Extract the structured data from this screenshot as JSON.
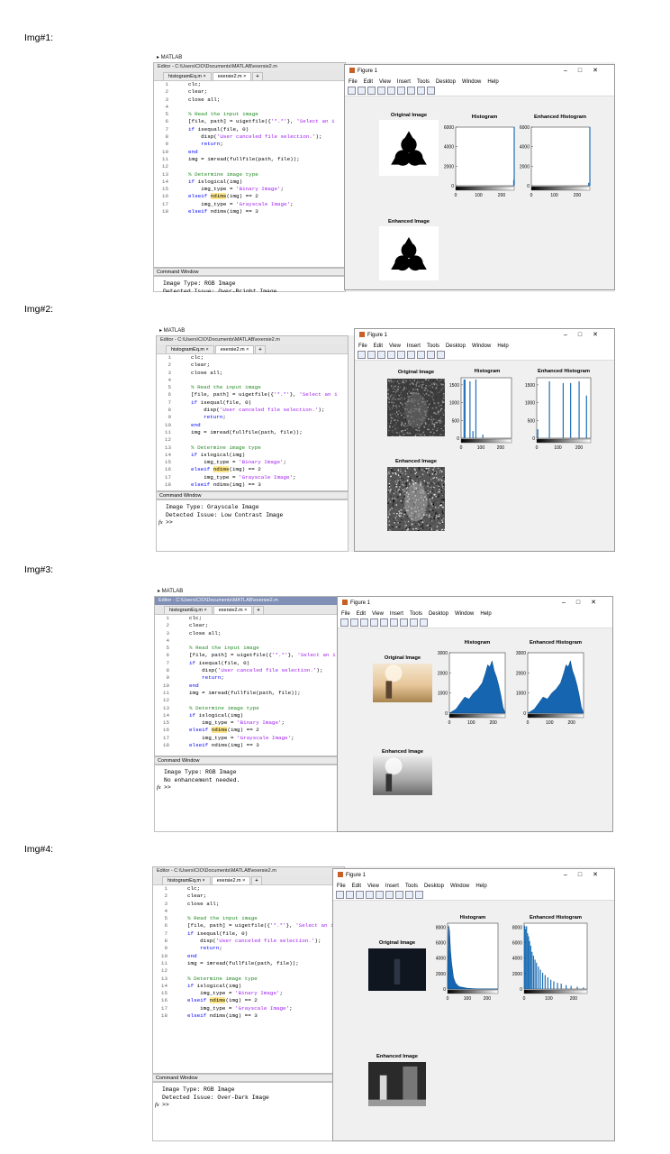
{
  "captions": [
    "Img#1:",
    "Img#2:",
    "Img#3:",
    "Img#4:"
  ],
  "matlab_label": "MATLAB",
  "editor": {
    "title": "Editor - C:\\Users\\CIO\\Documents\\MATLAB\\exersie2.m",
    "tabs": [
      "histogramEq.m",
      "exersie2.m",
      "+"
    ],
    "code_lines": [
      {
        "n": "1",
        "t": "clc;"
      },
      {
        "n": "2",
        "t": "clear;"
      },
      {
        "n": "3",
        "t": "close all;"
      },
      {
        "n": "4",
        "t": ""
      },
      {
        "n": "5",
        "t": "% Read the input image"
      },
      {
        "n": "6",
        "t": "[file, path] = uigetfile({'*.*'}, 'Select an i"
      },
      {
        "n": "7",
        "t": "if isequal(file, 0)"
      },
      {
        "n": "8",
        "t": "    disp('User canceled file selection.');"
      },
      {
        "n": "9",
        "t": "    return;"
      },
      {
        "n": "10",
        "t": "end"
      },
      {
        "n": "11",
        "t": "img = imread(fullfile(path, file));"
      },
      {
        "n": "12",
        "t": ""
      },
      {
        "n": "13",
        "t": "% Determine image type"
      },
      {
        "n": "14",
        "t": "if islogical(img)"
      },
      {
        "n": "15",
        "t": "    img_type = 'Binary Image';"
      },
      {
        "n": "16",
        "t": "elseif ndims(img) == 2"
      },
      {
        "n": "17",
        "t": "    img_type = 'Grayscale Image';"
      },
      {
        "n": "18",
        "t": "elseif ndims(img) == 3"
      }
    ]
  },
  "command_window": {
    "title": "Command Window",
    "prompt_symbol": "fx",
    "prompt": ">>"
  },
  "figure": {
    "title": "Figure 1",
    "menu": [
      "File",
      "Edit",
      "View",
      "Insert",
      "Tools",
      "Desktop",
      "Window",
      "Help"
    ],
    "window_buttons": [
      "–",
      "□",
      "✕"
    ],
    "original_title": "Original Image",
    "histogram_title": "Histogram",
    "enhanced_hist_title": "Enhanced Histogram",
    "enhanced_image_title": "Enhanced Image"
  },
  "shots": [
    {
      "output": [
        "Image Type: RGB Image",
        "Detected Issue: Over-Bright Image"
      ],
      "hist": {
        "yticks": [
          "6000",
          "4000",
          "2000",
          "0"
        ],
        "xticks": [
          "0",
          "100",
          "200"
        ]
      },
      "enh": {
        "yticks": [
          "6000",
          "4000",
          "2000",
          "0"
        ],
        "xticks": [
          "0",
          "100",
          "200"
        ]
      }
    },
    {
      "output": [
        "Image Type: Grayscale Image",
        "Detected Issue: Low Contrast Image"
      ],
      "hist": {
        "yticks": [
          "1500",
          "1000",
          "500",
          "0"
        ],
        "xticks": [
          "0",
          "100",
          "200"
        ]
      },
      "enh": {
        "yticks": [
          "1500",
          "1000",
          "500",
          "0"
        ],
        "xticks": [
          "0",
          "100",
          "200"
        ]
      }
    },
    {
      "output": [
        "Image Type: RGB Image",
        "No enhancement needed."
      ],
      "hist": {
        "yticks": [
          "3000",
          "2000",
          "1000",
          "0"
        ],
        "xticks": [
          "0",
          "100",
          "200"
        ]
      },
      "enh": {
        "yticks": [
          "3000",
          "2000",
          "1000",
          "0"
        ],
        "xticks": [
          "0",
          "100",
          "200"
        ]
      }
    },
    {
      "output": [
        "Image Type: RGB Image",
        "Detected Issue: Over-Dark Image"
      ],
      "hist": {
        "yticks": [
          "8000",
          "6000",
          "4000",
          "2000",
          "0"
        ],
        "xticks": [
          "0",
          "100",
          "200"
        ]
      },
      "enh": {
        "yticks": [
          "8000",
          "6000",
          "4000",
          "2000",
          "0"
        ],
        "xticks": [
          "0",
          "100",
          "200"
        ]
      }
    }
  ],
  "chart_data": [
    {
      "type": "bar",
      "title": "Histogram",
      "panel": "Img#1",
      "xlim": [
        0,
        255
      ],
      "ylim": [
        0,
        6000
      ],
      "bars": [
        {
          "x": 253,
          "y": 600
        },
        {
          "x": 255,
          "y": 6000
        }
      ]
    },
    {
      "type": "bar",
      "title": "Enhanced Histogram",
      "panel": "Img#1",
      "xlim": [
        0,
        255
      ],
      "ylim": [
        0,
        6000
      ],
      "bars": [
        {
          "x": 250,
          "y": 300
        },
        {
          "x": 255,
          "y": 6000
        }
      ]
    },
    {
      "type": "bar",
      "title": "Histogram",
      "panel": "Img#2",
      "xlim": [
        0,
        255
      ],
      "ylim": [
        0,
        1700
      ],
      "bars": [
        {
          "x": 15,
          "y": 1650
        },
        {
          "x": 20,
          "y": 1650
        },
        {
          "x": 45,
          "y": 1600
        },
        {
          "x": 60,
          "y": 200
        },
        {
          "x": 75,
          "y": 1650
        },
        {
          "x": 110,
          "y": 100
        }
      ]
    },
    {
      "type": "bar",
      "title": "Enhanced Histogram",
      "panel": "Img#2",
      "xlim": [
        0,
        255
      ],
      "ylim": [
        0,
        1700
      ],
      "bars": [
        {
          "x": 5,
          "y": 250
        },
        {
          "x": 60,
          "y": 1600
        },
        {
          "x": 125,
          "y": 1550
        },
        {
          "x": 160,
          "y": 1550
        },
        {
          "x": 200,
          "y": 1600
        },
        {
          "x": 235,
          "y": 1200
        }
      ]
    },
    {
      "type": "area",
      "title": "Histogram",
      "panel": "Img#3",
      "xlim": [
        0,
        255
      ],
      "ylim": [
        0,
        3000
      ],
      "x": [
        0,
        30,
        50,
        70,
        90,
        110,
        130,
        150,
        165,
        175,
        185,
        195,
        205,
        215,
        225,
        235,
        245,
        255
      ],
      "y": [
        0,
        200,
        500,
        800,
        700,
        1000,
        1200,
        1500,
        2000,
        2400,
        2300,
        2600,
        2100,
        1800,
        1400,
        900,
        300,
        0
      ]
    },
    {
      "type": "area",
      "title": "Enhanced Histogram",
      "panel": "Img#3",
      "xlim": [
        0,
        255
      ],
      "ylim": [
        0,
        3000
      ],
      "x": [
        0,
        30,
        50,
        70,
        90,
        110,
        130,
        150,
        165,
        175,
        185,
        195,
        205,
        215,
        225,
        235,
        245,
        255
      ],
      "y": [
        0,
        200,
        500,
        800,
        700,
        1000,
        1200,
        1500,
        2000,
        2400,
        2300,
        2600,
        2100,
        1800,
        1400,
        900,
        300,
        0
      ]
    },
    {
      "type": "area",
      "title": "Histogram",
      "panel": "Img#4",
      "xlim": [
        0,
        255
      ],
      "ylim": [
        0,
        8500
      ],
      "x": [
        0,
        5,
        10,
        15,
        20,
        25,
        30,
        40,
        50,
        60,
        80,
        100,
        130,
        160,
        200,
        255
      ],
      "y": [
        2000,
        8200,
        7500,
        5000,
        3500,
        2500,
        1500,
        800,
        500,
        300,
        200,
        100,
        50,
        20,
        10,
        0
      ]
    },
    {
      "type": "bar",
      "title": "Enhanced Histogram",
      "panel": "Img#4",
      "xlim": [
        0,
        255
      ],
      "ylim": [
        0,
        8500
      ],
      "bars": [
        {
          "x": 2,
          "y": 8200
        },
        {
          "x": 6,
          "y": 7800
        },
        {
          "x": 10,
          "y": 8100
        },
        {
          "x": 14,
          "y": 7200
        },
        {
          "x": 18,
          "y": 6800
        },
        {
          "x": 22,
          "y": 6200
        },
        {
          "x": 27,
          "y": 5600
        },
        {
          "x": 32,
          "y": 4800
        },
        {
          "x": 38,
          "y": 4300
        },
        {
          "x": 44,
          "y": 3800
        },
        {
          "x": 50,
          "y": 3400
        },
        {
          "x": 58,
          "y": 2900
        },
        {
          "x": 66,
          "y": 2500
        },
        {
          "x": 75,
          "y": 2100
        },
        {
          "x": 85,
          "y": 1800
        },
        {
          "x": 96,
          "y": 1500
        },
        {
          "x": 108,
          "y": 1200
        },
        {
          "x": 120,
          "y": 1000
        },
        {
          "x": 135,
          "y": 800
        },
        {
          "x": 150,
          "y": 700
        },
        {
          "x": 170,
          "y": 500
        },
        {
          "x": 190,
          "y": 400
        },
        {
          "x": 215,
          "y": 300
        },
        {
          "x": 240,
          "y": 200
        }
      ]
    }
  ]
}
